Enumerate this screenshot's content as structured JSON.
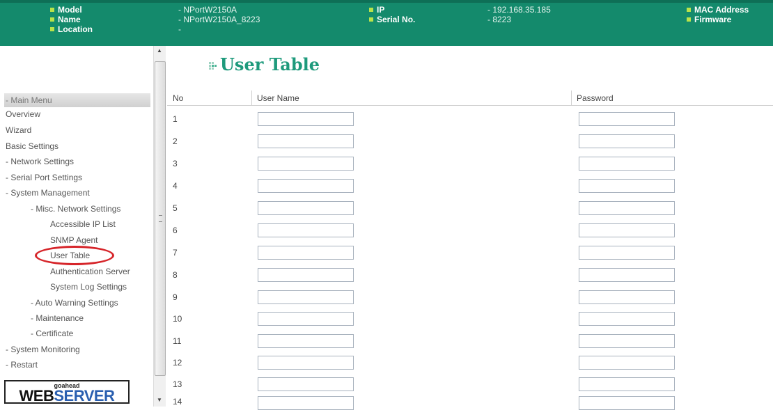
{
  "header": {
    "model_label": "Model",
    "model_value": "- NPortW2150A",
    "name_label": "Name",
    "name_value": "- NPortW2150A_8223",
    "location_label": "Location",
    "location_value": "-",
    "ip_label": "IP",
    "ip_value": "- 192.168.35.185",
    "serial_label": "Serial No.",
    "serial_value": "- 8223",
    "mac_label": "MAC Address",
    "firmware_label": "Firmware"
  },
  "sidebar": {
    "main_menu": "- Main Menu",
    "items": [
      {
        "label": "Overview"
      },
      {
        "label": "Wizard"
      },
      {
        "label": "Basic Settings"
      },
      {
        "label": "- Network Settings"
      },
      {
        "label": "- Serial Port Settings"
      },
      {
        "label": "- System Management"
      },
      {
        "label": "- Misc. Network Settings"
      },
      {
        "label": "Accessible IP List"
      },
      {
        "label": "SNMP Agent"
      },
      {
        "label": "User Table"
      },
      {
        "label": "Authentication Server"
      },
      {
        "label": "System Log Settings"
      },
      {
        "label": "- Auto Warning Settings"
      },
      {
        "label": "- Maintenance"
      },
      {
        "label": "- Certificate"
      },
      {
        "label": "- System Monitoring"
      },
      {
        "label": "- Restart"
      }
    ],
    "logo_top": "goahead",
    "logo_web": "WEB",
    "logo_server": "SERVER"
  },
  "main": {
    "title": "User Table",
    "columns": {
      "no": "No",
      "user_name": "User Name",
      "password": "Password"
    },
    "rows": [
      {
        "no": "1",
        "user_name": "",
        "password": ""
      },
      {
        "no": "2",
        "user_name": "",
        "password": ""
      },
      {
        "no": "3",
        "user_name": "",
        "password": ""
      },
      {
        "no": "4",
        "user_name": "",
        "password": ""
      },
      {
        "no": "5",
        "user_name": "",
        "password": ""
      },
      {
        "no": "6",
        "user_name": "",
        "password": ""
      },
      {
        "no": "7",
        "user_name": "",
        "password": ""
      },
      {
        "no": "8",
        "user_name": "",
        "password": ""
      },
      {
        "no": "9",
        "user_name": "",
        "password": ""
      },
      {
        "no": "10",
        "user_name": "",
        "password": ""
      },
      {
        "no": "11",
        "user_name": "",
        "password": ""
      },
      {
        "no": "12",
        "user_name": "",
        "password": ""
      },
      {
        "no": "13",
        "user_name": "",
        "password": ""
      },
      {
        "no": "14",
        "user_name": "",
        "password": ""
      }
    ]
  },
  "colors": {
    "header_bg": "#148a6c",
    "bullet": "#b9e34a",
    "title": "#1e9a7c",
    "highlight": "#d6252a"
  }
}
